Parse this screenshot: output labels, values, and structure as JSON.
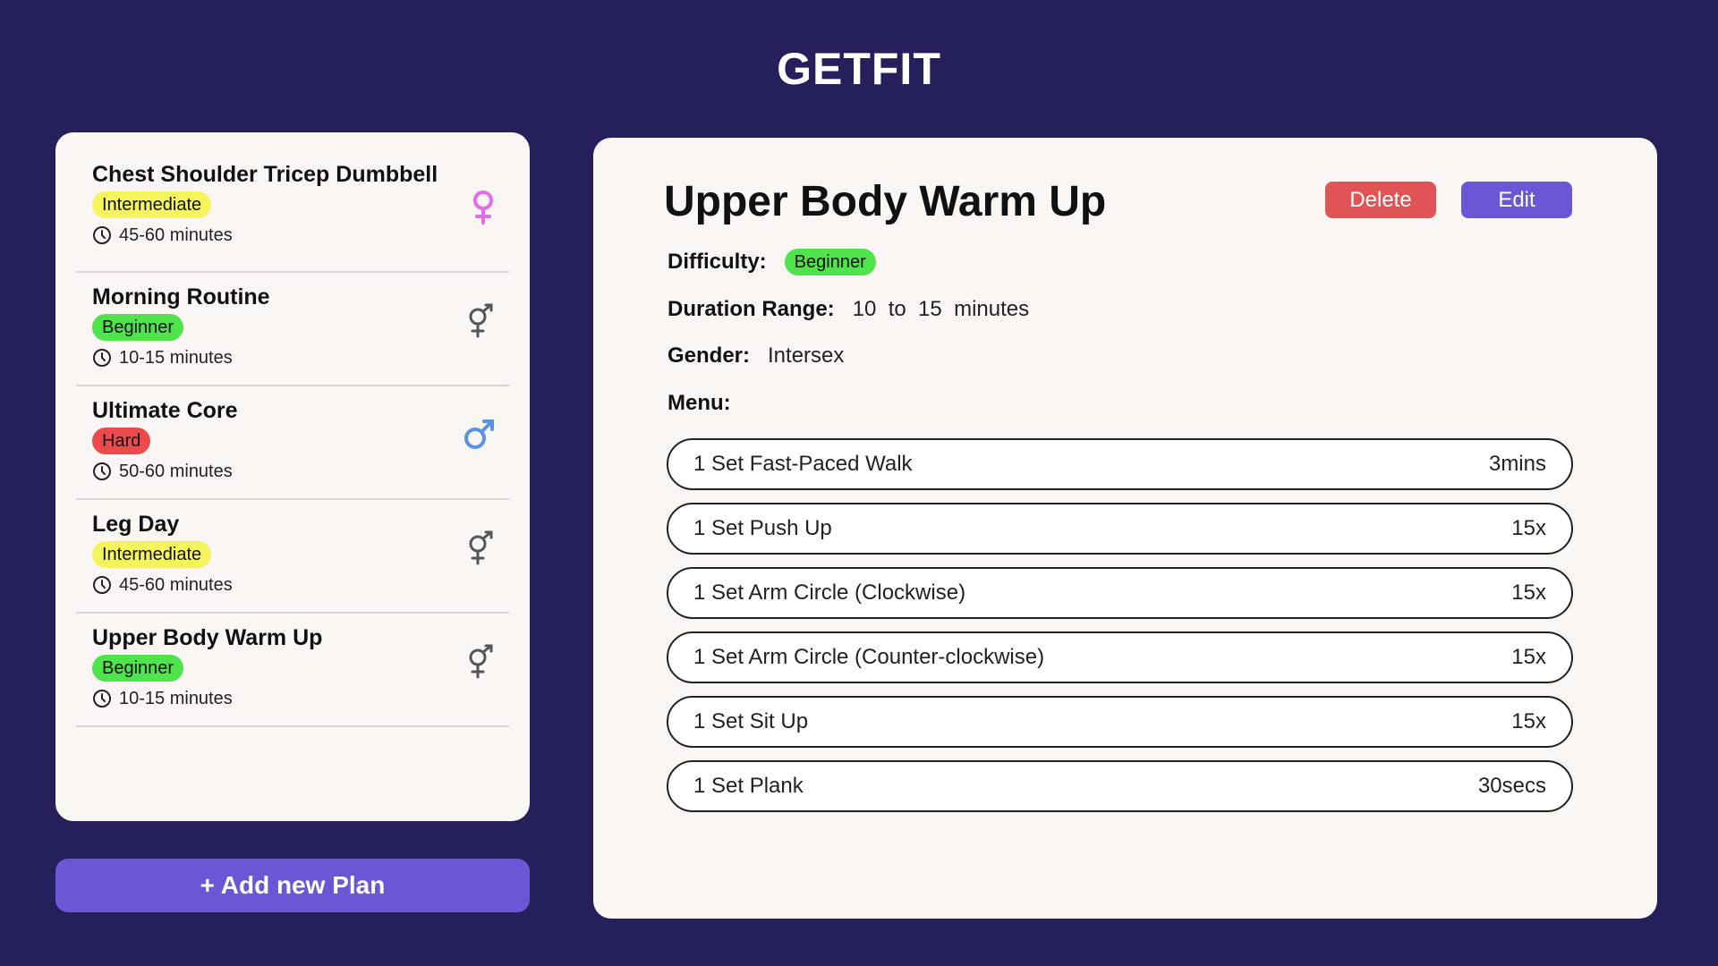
{
  "app": {
    "title": "GETFIT"
  },
  "plans": [
    {
      "name": "Chest Shoulder Tricep Dumbbell",
      "difficulty": "Intermediate",
      "duration": "45-60 minutes",
      "gender_icon": "female-icon"
    },
    {
      "name": "Morning Routine",
      "difficulty": "Beginner",
      "duration": "10-15 minutes",
      "gender_icon": "intersex-icon"
    },
    {
      "name": "Ultimate Core",
      "difficulty": "Hard",
      "duration": "50-60 minutes",
      "gender_icon": "male-icon"
    },
    {
      "name": "Leg Day",
      "difficulty": "Intermediate",
      "duration": "45-60 minutes",
      "gender_icon": "intersex-icon"
    },
    {
      "name": "Upper Body Warm Up",
      "difficulty": "Beginner",
      "duration": "10-15 minutes",
      "gender_icon": "intersex-icon"
    }
  ],
  "add_plan_label": "+ Add new Plan",
  "detail": {
    "title": "Upper Body Warm Up",
    "delete_label": "Delete",
    "edit_label": "Edit",
    "difficulty_label": "Difficulty:",
    "difficulty_value": "Beginner",
    "duration_label": "Duration Range:",
    "duration_value": "10  to  15  minutes",
    "gender_label": "Gender:",
    "gender_value": "Intersex",
    "menu_label": "Menu:",
    "menu": [
      {
        "name": "1 Set Fast-Paced Walk",
        "amount": "3mins"
      },
      {
        "name": "1 Set Push Up",
        "amount": "15x"
      },
      {
        "name": "1 Set Arm Circle (Clockwise)",
        "amount": "15x"
      },
      {
        "name": "1 Set Arm Circle (Counter-clockwise)",
        "amount": "15x"
      },
      {
        "name": "1 Set Sit Up",
        "amount": "15x"
      },
      {
        "name": "1 Set Plank",
        "amount": "30secs"
      }
    ]
  },
  "colors": {
    "background": "#25205c",
    "accent": "#6a57d6",
    "delete": "#e05456",
    "beginner": "#4fe34c",
    "intermediate": "#f6f45c",
    "hard": "#ed4b4b",
    "female": "#e66be6",
    "male": "#5a93e6",
    "intersex": "#555555"
  }
}
